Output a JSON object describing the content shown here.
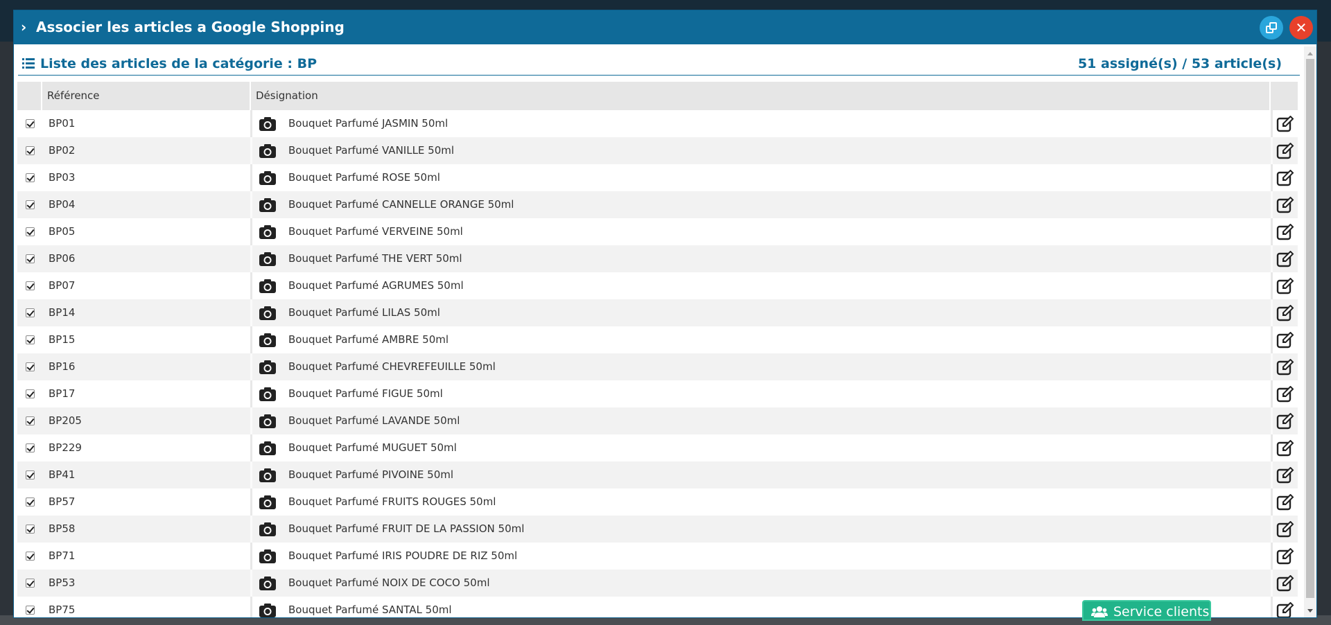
{
  "modal": {
    "title": "Associer les articles a Google Shopping",
    "copy_button": "copy-icon",
    "close_button": "close-icon"
  },
  "list": {
    "title": "Liste des articles de la catégorie : BP",
    "count": "51 assigné(s) / 53 article(s)"
  },
  "table": {
    "headers": {
      "reference": "Référence",
      "designation": "Désignation"
    },
    "rows": [
      {
        "ref": "BP01",
        "des": "Bouquet Parfumé JASMIN 50ml",
        "checked": true
      },
      {
        "ref": "BP02",
        "des": "Bouquet Parfumé VANILLE 50ml",
        "checked": true
      },
      {
        "ref": "BP03",
        "des": "Bouquet Parfumé ROSE 50ml",
        "checked": true
      },
      {
        "ref": "BP04",
        "des": "Bouquet Parfumé CANNELLE ORANGE 50ml",
        "checked": true
      },
      {
        "ref": "BP05",
        "des": "Bouquet Parfumé VERVEINE 50ml",
        "checked": true
      },
      {
        "ref": "BP06",
        "des": "Bouquet Parfumé THE VERT 50ml",
        "checked": true
      },
      {
        "ref": "BP07",
        "des": "Bouquet Parfumé AGRUMES 50ml",
        "checked": true
      },
      {
        "ref": "BP14",
        "des": "Bouquet Parfumé LILAS 50ml",
        "checked": true
      },
      {
        "ref": "BP15",
        "des": "Bouquet Parfumé AMBRE 50ml",
        "checked": true
      },
      {
        "ref": "BP16",
        "des": "Bouquet Parfumé CHEVREFEUILLE 50ml",
        "checked": true
      },
      {
        "ref": "BP17",
        "des": "Bouquet Parfumé FIGUE 50ml",
        "checked": true
      },
      {
        "ref": "BP205",
        "des": "Bouquet Parfumé LAVANDE 50ml",
        "checked": true
      },
      {
        "ref": "BP229",
        "des": "Bouquet Parfumé MUGUET 50ml",
        "checked": true
      },
      {
        "ref": "BP41",
        "des": "Bouquet Parfumé PIVOINE 50ml",
        "checked": true
      },
      {
        "ref": "BP57",
        "des": "Bouquet Parfumé FRUITS ROUGES 50ml",
        "checked": true
      },
      {
        "ref": "BP58",
        "des": "Bouquet Parfumé FRUIT DE LA PASSION 50ml",
        "checked": true
      },
      {
        "ref": "BP71",
        "des": "Bouquet Parfumé IRIS POUDRE DE RIZ 50ml",
        "checked": true
      },
      {
        "ref": "BP53",
        "des": "Bouquet Parfumé NOIX DE COCO 50ml",
        "checked": true
      },
      {
        "ref": "BP75",
        "des": "Bouquet Parfumé SANTAL 50ml",
        "checked": true
      }
    ]
  },
  "service": {
    "label": "Service clients"
  },
  "colors": {
    "header": "#0f6a98",
    "copy": "#2aa6dc",
    "close": "#e8412b",
    "service": "#21b48a"
  }
}
